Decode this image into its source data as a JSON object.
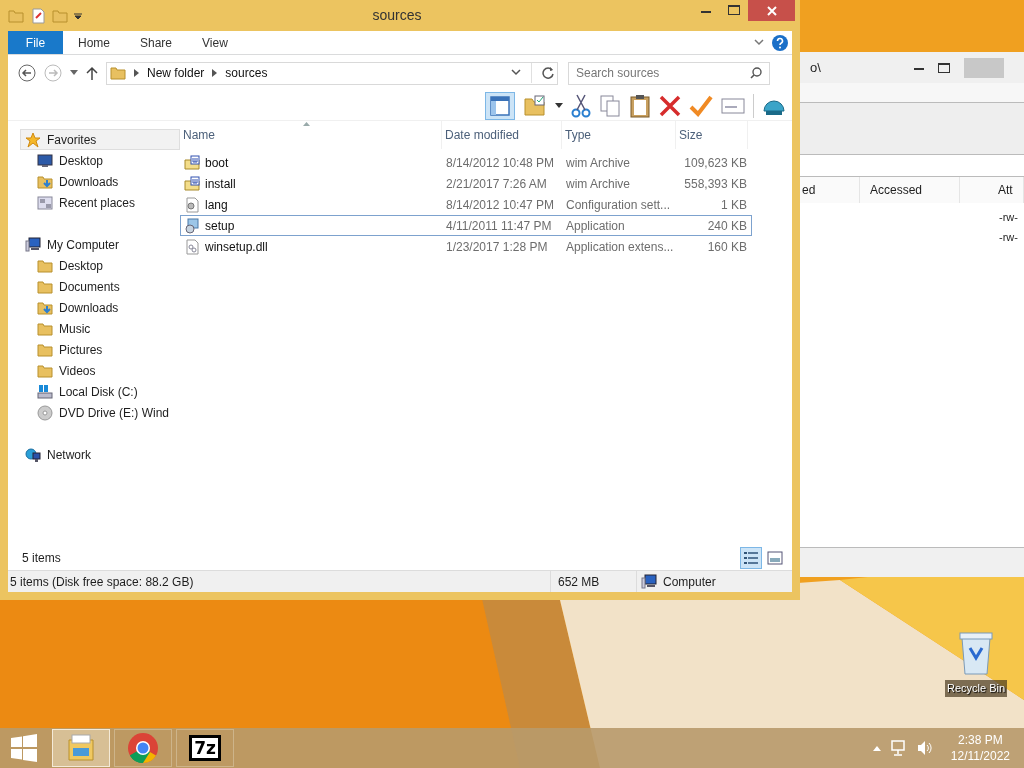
{
  "background_window": {
    "title": "o\\",
    "columns": [
      "ed",
      "Accessed",
      "Att"
    ],
    "rows": [
      {
        "attributes": "-rw-"
      },
      {
        "attributes": "-rw-"
      }
    ]
  },
  "explorer": {
    "title": "sources",
    "ribbon_tabs": [
      {
        "label": "File",
        "kind": "file"
      },
      {
        "label": "Home",
        "kind": "tab"
      },
      {
        "label": "Share",
        "kind": "tab"
      },
      {
        "label": "View",
        "kind": "tab"
      }
    ],
    "breadcrumb": [
      "New folder",
      "sources"
    ],
    "search": {
      "placeholder": "Search sources"
    },
    "navigation": [
      {
        "label": "Favorites",
        "kind": "star",
        "selected": true,
        "children": [
          {
            "label": "Desktop",
            "kind": "desktop",
            "selected": false
          },
          {
            "label": "Downloads",
            "kind": "downloads",
            "selected": false
          },
          {
            "label": "Recent places",
            "kind": "recent",
            "selected": false
          }
        ]
      },
      {
        "label": "My Computer",
        "kind": "computer",
        "selected": false,
        "children": [
          {
            "label": "Desktop",
            "kind": "folder",
            "selected": false
          },
          {
            "label": "Documents",
            "kind": "folder",
            "selected": false
          },
          {
            "label": "Downloads",
            "kind": "downloads",
            "selected": false
          },
          {
            "label": "Music",
            "kind": "folder",
            "selected": false
          },
          {
            "label": "Pictures",
            "kind": "folder",
            "selected": false
          },
          {
            "label": "Videos",
            "kind": "folder",
            "selected": false
          },
          {
            "label": "Local Disk (C:)",
            "kind": "disk",
            "selected": false
          },
          {
            "label": "DVD Drive (E:) Wind",
            "kind": "dvd",
            "selected": false
          }
        ]
      },
      {
        "label": "Network",
        "kind": "network",
        "selected": false
      }
    ],
    "columns": [
      {
        "label": "Name",
        "sorted": true
      },
      {
        "label": "Date modified"
      },
      {
        "label": "Type"
      },
      {
        "label": "Size"
      }
    ],
    "rows": [
      {
        "name": "boot",
        "date": "8/14/2012 10:48 PM",
        "type": "wim Archive",
        "size": "109,623 KB",
        "kind": "archive",
        "selected": false
      },
      {
        "name": "install",
        "date": "2/21/2017 7:26 AM",
        "type": "wim Archive",
        "size": "558,393 KB",
        "kind": "archive",
        "selected": false
      },
      {
        "name": "lang",
        "date": "8/14/2012 10:47 PM",
        "type": "Configuration sett...",
        "size": "1 KB",
        "kind": "config",
        "selected": false
      },
      {
        "name": "setup",
        "date": "4/11/2011 11:47 PM",
        "type": "Application",
        "size": "240 KB",
        "kind": "application",
        "selected": true
      },
      {
        "name": "winsetup.dll",
        "date": "1/23/2017 1:28 PM",
        "type": "Application extens...",
        "size": "160 KB",
        "kind": "dll",
        "selected": false
      }
    ],
    "item_count": "5 items",
    "view_buttons": [
      {
        "kind": "details",
        "selected": true
      },
      {
        "kind": "preview",
        "selected": false
      }
    ],
    "status_bar": {
      "summary": "5 items (Disk free space: 88.2 GB)",
      "size": "652 MB",
      "location": "Computer"
    }
  },
  "desktop_icons": [
    {
      "label": "Recycle Bin"
    }
  ],
  "taskbar": {
    "apps": [
      {
        "kind": "explorer",
        "selected": true
      },
      {
        "kind": "chrome",
        "selected": false
      },
      {
        "kind": "sevenzip",
        "label": "7z",
        "selected": false
      }
    ],
    "time": "2:38 PM",
    "date": "12/11/2022"
  }
}
